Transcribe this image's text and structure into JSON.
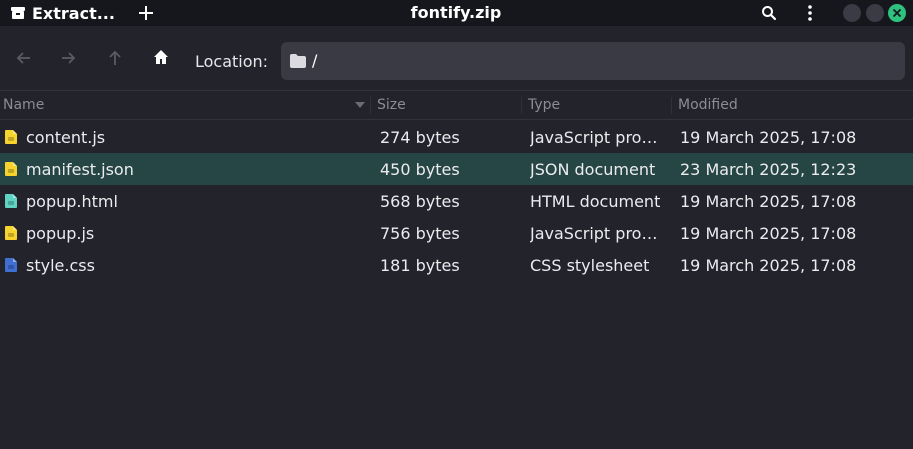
{
  "titlebar": {
    "extract_label": "Extract...",
    "title": "fontify.zip"
  },
  "toolbar": {
    "location_label": "Location:",
    "location_path": "/"
  },
  "columns": {
    "name": "Name",
    "size": "Size",
    "type": "Type",
    "modified": "Modified"
  },
  "files": [
    {
      "name": "content.js",
      "size": "274 bytes",
      "type": "JavaScript pro…",
      "modified": "19 March 2025, 17:08",
      "icon": "javascript-file-icon",
      "icon_color": "#f6d32d",
      "selected": false
    },
    {
      "name": "manifest.json",
      "size": "450 bytes",
      "type": "JSON document",
      "modified": "23 March 2025, 12:23",
      "icon": "json-file-icon",
      "icon_color": "#f6d32d",
      "selected": true
    },
    {
      "name": "popup.html",
      "size": "568 bytes",
      "type": "HTML document",
      "modified": "19 March 2025, 17:08",
      "icon": "html-file-icon",
      "icon_color": "#5fd3c4",
      "selected": false
    },
    {
      "name": "popup.js",
      "size": "756 bytes",
      "type": "JavaScript pro…",
      "modified": "19 March 2025, 17:08",
      "icon": "javascript-file-icon",
      "icon_color": "#f6d32d",
      "selected": false
    },
    {
      "name": "style.css",
      "size": "181 bytes",
      "type": "CSS stylesheet",
      "modified": "19 March 2025, 17:08",
      "icon": "css-file-icon",
      "icon_color": "#3f6fd1",
      "selected": false
    }
  ],
  "colors": {
    "background": "#22232b",
    "titlebar": "#16171d",
    "selected_row": "#264645",
    "close_button": "#2ec27e",
    "location_field": "#393a44"
  }
}
